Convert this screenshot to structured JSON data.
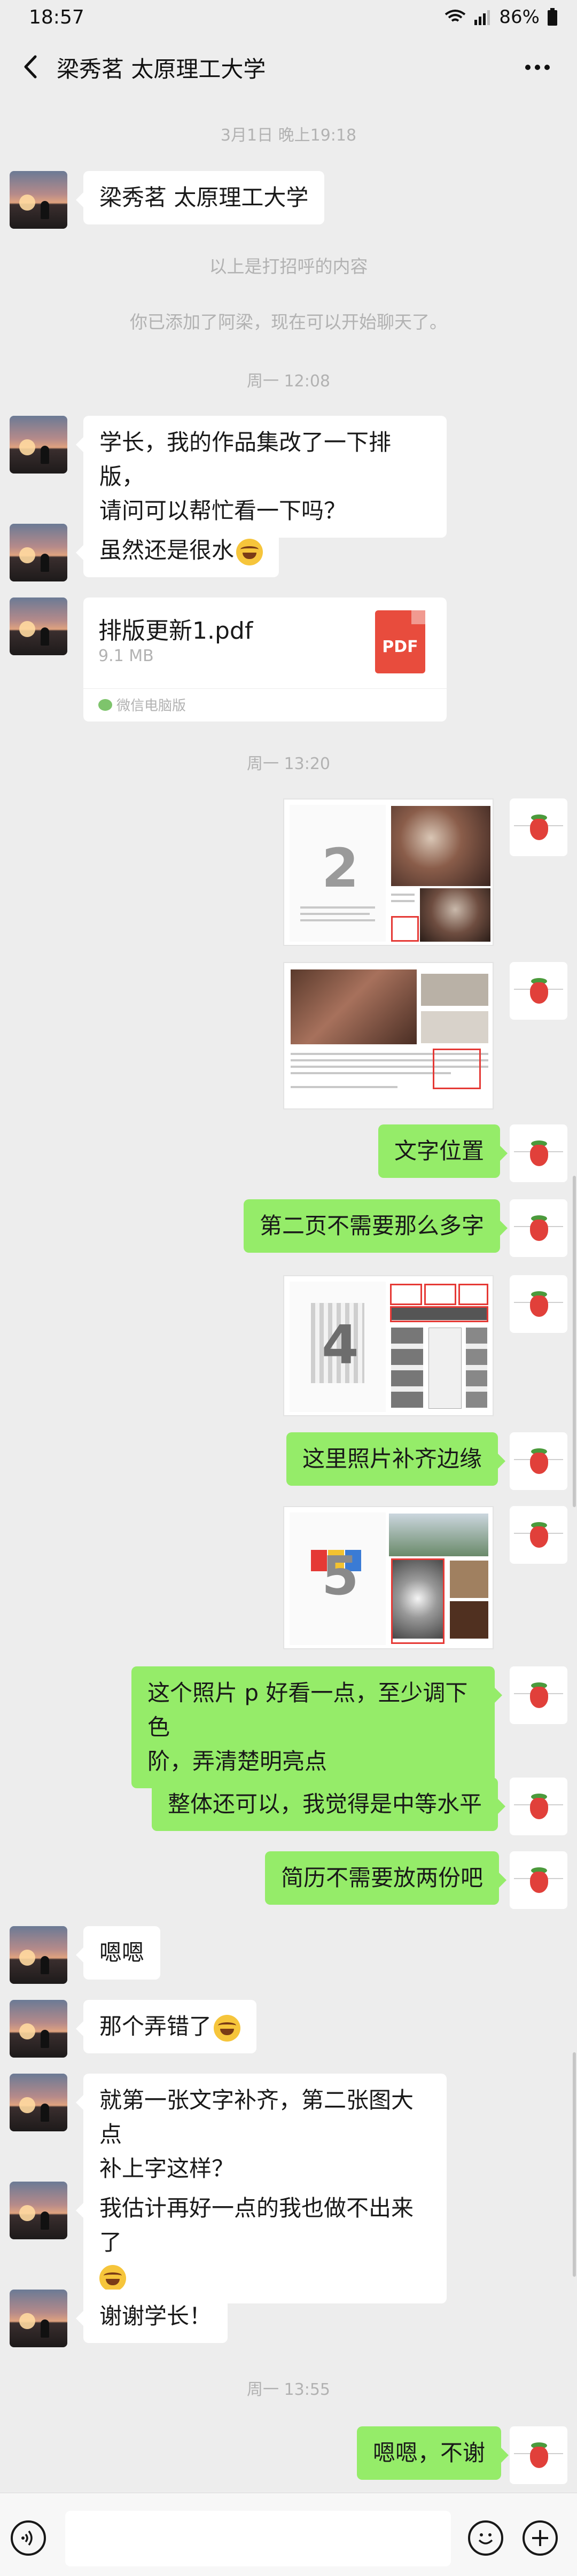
{
  "status_bar": {
    "time": "18:57",
    "battery": "86%"
  },
  "header": {
    "title": "梁秀茗 太原理工大学",
    "more": "···"
  },
  "timestamps": [
    "3月1日 晚上19:18",
    "周一 12:08",
    "周一 13:20",
    "周一 13:55"
  ],
  "system": {
    "greeting_note": "以上是打招呼的内容",
    "added_note": "你已添加了阿梁，现在可以开始聊天了。"
  },
  "messages": {
    "m1": "梁秀茗 太原理工大学",
    "m2_line1": "学长，我的作品集改了一下排版，",
    "m2_line2": "请问可以帮忙看一下吗？",
    "m3": "虽然还是很水",
    "m4": "文字位置",
    "m5": "第二页不需要那么多字",
    "m6": "这里照片补齐边缘",
    "m7_line1": "这个照片 p 好看一点，至少调下色",
    "m7_line2": "阶，弄清楚明亮点",
    "m8": "整体还可以，我觉得是中等水平",
    "m9": "简历不需要放两份吧",
    "m10": "嗯嗯",
    "m11": "那个弄错了",
    "m12_line1": "就第一张文字补齐，第二张图大点",
    "m12_line2": "补上字这样？",
    "m13_line1": "我估计再好一点的我也做不出来了",
    "m14": "谢谢学长！",
    "m15": "嗯嗯，不谢"
  },
  "file": {
    "name": "排版更新1.pdf",
    "size": "9.1 MB",
    "source": "微信电脑版",
    "icon_label": "PDF"
  },
  "images": {
    "page_numbers": [
      "2",
      "4",
      "5"
    ]
  },
  "colors": {
    "background": "#ededed",
    "outgoing_bubble": "#95ec69",
    "incoming_bubble": "#ffffff",
    "pdf_red": "#e84c3d"
  },
  "icons": [
    "back-arrow-icon",
    "more-icon",
    "wifi-icon",
    "signal-icon",
    "battery-icon",
    "voice-icon",
    "emoji-icon",
    "plus-icon",
    "pdf-icon"
  ]
}
